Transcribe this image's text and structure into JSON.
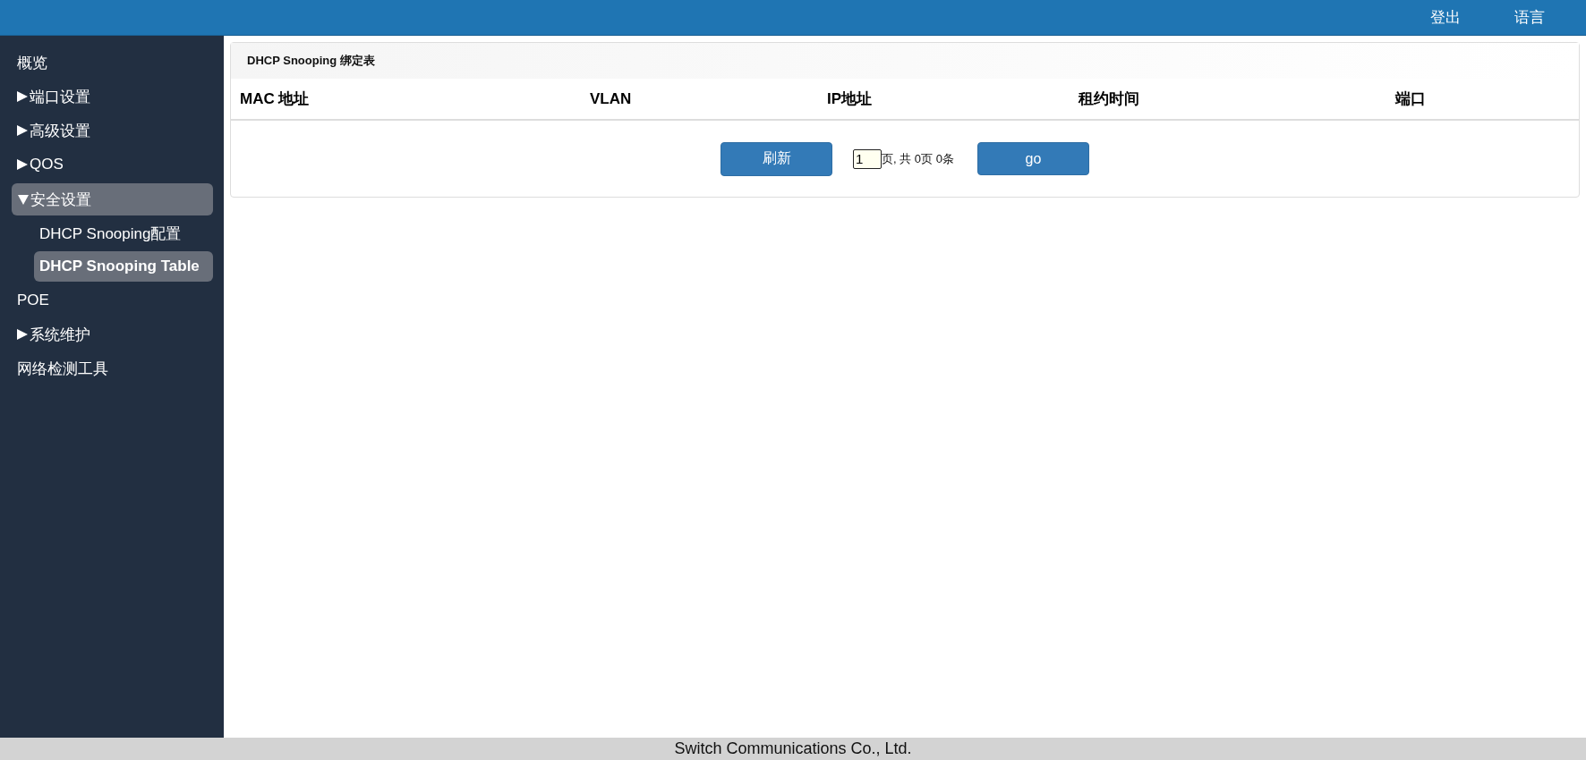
{
  "top_bar": {
    "links": [
      "登出",
      "语言"
    ]
  },
  "sidebar": {
    "items": [
      {
        "label": "概览"
      },
      {
        "label": "端口设置",
        "expanded": false
      },
      {
        "label": "高级设置",
        "expanded": false
      },
      {
        "label": "QOS",
        "expanded": false
      },
      {
        "label": "安全设置",
        "expanded": true,
        "children": [
          {
            "label": "DHCP Snooping配置",
            "selected": false
          },
          {
            "label": "DHCP Snooping Table",
            "selected": true
          }
        ]
      },
      {
        "label": "POE"
      },
      {
        "label": "系统维护",
        "expanded": false
      },
      {
        "label": "网络检测工具"
      }
    ]
  },
  "panel": {
    "title": "DHCP Snooping 绑定表",
    "table": {
      "columns": [
        "MAC 地址",
        "VLAN",
        "IP地址",
        "租约时间",
        "端口"
      ]
    },
    "pagination": {
      "refresh_button": "刷新",
      "page_value": "1",
      "summary": "页, 共 0页 0条",
      "go_button": "go"
    }
  },
  "footer": {
    "text": "Switch Communications Co., Ltd."
  }
}
